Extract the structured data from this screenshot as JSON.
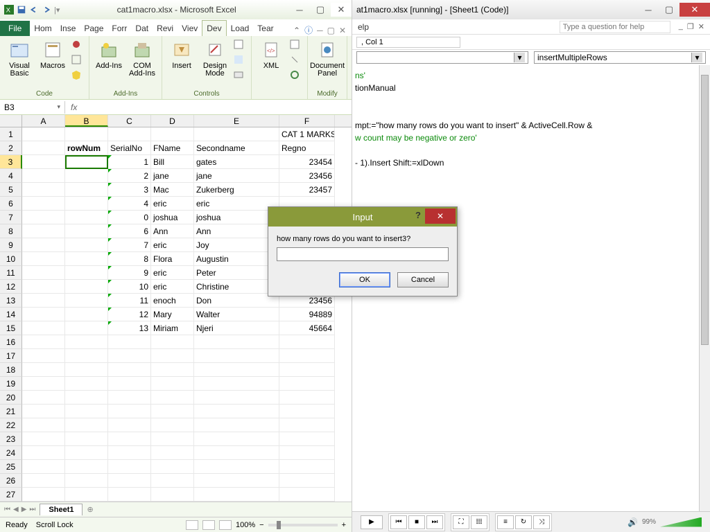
{
  "excel": {
    "title": "cat1macro.xlsx - Microsoft Excel",
    "file_tab": "File",
    "tabs": [
      "Hom",
      "Inse",
      "Page",
      "Forr",
      "Dat",
      "Revi",
      "Viev",
      "Dev",
      "Load",
      "Tear"
    ],
    "active_tab_index": 7,
    "groups": {
      "code": {
        "name": "Code",
        "items": [
          "Visual Basic",
          "Macros"
        ]
      },
      "addins": {
        "name": "Add-Ins",
        "items": [
          "Add-Ins",
          "COM Add-Ins"
        ]
      },
      "controls": {
        "name": "Controls",
        "items": [
          "Insert",
          "Design Mode"
        ]
      },
      "xml": {
        "name": " ",
        "items": [
          "XML"
        ]
      },
      "modify": {
        "name": "Modify",
        "items": [
          "Document Panel"
        ]
      }
    },
    "namebox": "B3",
    "columns": [
      "A",
      "B",
      "C",
      "D",
      "E",
      "F"
    ],
    "headers_row": {
      "F": "CAT 1 MARKS"
    },
    "table_head": {
      "B": "rowNum",
      "C": "SerialNo",
      "D": "FName",
      "E": "Secondname",
      "F": "Regno"
    },
    "rows": [
      {
        "C": "1",
        "D": "Bill",
        "E": "gates",
        "F": "23454"
      },
      {
        "C": "2",
        "D": "jane",
        "E": "jane",
        "F": "23456"
      },
      {
        "C": "3",
        "D": "Mac",
        "E": "Zukerberg",
        "F": "23457"
      },
      {
        "C": "4",
        "D": "eric",
        "E": "eric",
        "F": ""
      },
      {
        "C": "0",
        "D": "joshua",
        "E": "joshua",
        "F": ""
      },
      {
        "C": "6",
        "D": "Ann",
        "E": "Ann",
        "F": ""
      },
      {
        "C": "7",
        "D": "eric",
        "E": "Joy",
        "F": ""
      },
      {
        "C": "8",
        "D": "Flora",
        "E": "Augustin",
        "F": ""
      },
      {
        "C": "9",
        "D": "eric",
        "E": "Peter",
        "F": ""
      },
      {
        "C": "10",
        "D": "eric",
        "E": "Christine",
        "F": ""
      },
      {
        "C": "11",
        "D": "enoch",
        "E": "Don",
        "F": "23456"
      },
      {
        "C": "12",
        "D": "Mary",
        "E": "Walter",
        "F": "94889"
      },
      {
        "C": "13",
        "D": "Miriam",
        "E": "Njeri",
        "F": "45664"
      }
    ],
    "sheet_tab": "Sheet1",
    "status": {
      "ready": "Ready",
      "scrolllock": "Scroll Lock",
      "zoom": "100%"
    }
  },
  "vbe": {
    "title": "at1macro.xlsx [running] - [Sheet1 (Code)]",
    "menu_help": "elp",
    "ask_placeholder": "Type a question for help",
    "cursor_pos": ", Col 1",
    "combo_left": "",
    "combo_right": "insertMultipleRows",
    "code_lines": [
      {
        "cls": "green",
        "text": "ns'"
      },
      {
        "cls": "c1",
        "text": "tionManual"
      },
      {
        "cls": "c1",
        "text": ""
      },
      {
        "cls": "c1",
        "text": ""
      },
      {
        "cls": "c1",
        "text": "mpt:=\"how many rows do you want to insert\" & ActiveCell.Row &"
      },
      {
        "cls": "green",
        "text": "w count may be negative or zero'"
      },
      {
        "cls": "c1",
        "text": ""
      },
      {
        "cls": "c1",
        "text": "- 1).Insert Shift:=xlDown"
      }
    ]
  },
  "dialog": {
    "title": "Input",
    "prompt": "how many rows do you want to insert3?",
    "value": "",
    "ok": "OK",
    "cancel": "Cancel"
  },
  "media": {
    "volume": "99%"
  }
}
